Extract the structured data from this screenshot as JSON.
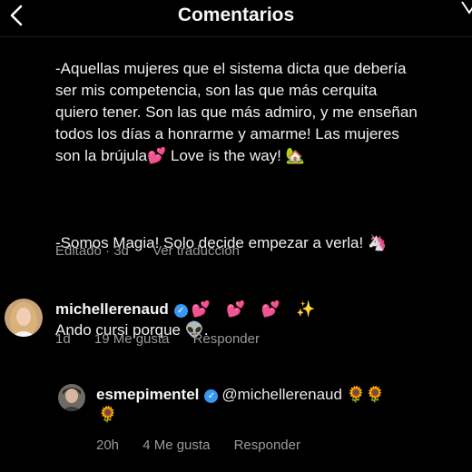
{
  "header": {
    "title": "Comentarios"
  },
  "post": {
    "paragraph_1": "-Aquellas mujeres que el sistema dicta que debería\nser mis competencia, son las que más cerquita\nquiero tener. Son las que más admiro, y me enseñan\ntodos los días a honrarme y amarme! Las mujeres\nson la brújula💕 Love is the way! 🏡",
    "paragraph_2": "-Somos Magia! Solo decide empezar a verla! 🦄",
    "paragraph_3": "Ando cursi porque 👽.",
    "edited_label": "Editado",
    "age": "3d",
    "translate_label": "Ver traducción"
  },
  "comments": [
    {
      "username": "michellerenaud",
      "text": "💕 💕 💕 ✨",
      "age": "1d",
      "likes": "19 Me gusta",
      "reply_label": "Responder"
    },
    {
      "username": "esmepimentel",
      "mention": "@michellerenaud",
      "text_inline": "🌻🌻",
      "text_wrap": "🌻",
      "age": "20h",
      "likes": "4 Me gusta",
      "reply_label": "Responder"
    }
  ],
  "colors": {
    "background": "#000000",
    "verified_badge": "#3897f0",
    "meta_text": "#9a9a9a"
  }
}
